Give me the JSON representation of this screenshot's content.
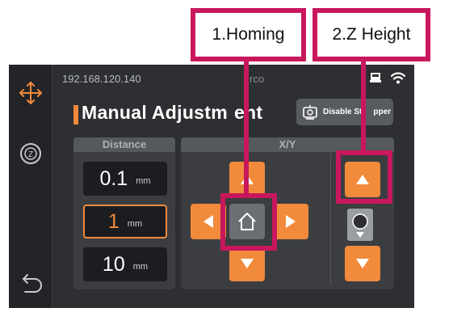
{
  "callouts": {
    "homing": "1.Homing",
    "z_height": "2.Z Height"
  },
  "status_bar": {
    "ip": "192.168.120.140",
    "brand_partial": "rco"
  },
  "page": {
    "title_part1": "Manual Adjustm",
    "title_part2": "ent",
    "disable_stepper_part1": "Disable St",
    "disable_stepper_part2": "pper"
  },
  "distance": {
    "header": "Distance",
    "options": [
      {
        "value": "0.1",
        "unit": "mm",
        "selected": false
      },
      {
        "value": "1",
        "unit": "mm",
        "selected": true
      },
      {
        "value": "10",
        "unit": "mm",
        "selected": false
      }
    ]
  },
  "xy": {
    "header": "X/Y"
  },
  "icons": {
    "sidebar": [
      "move-icon",
      "z-offset-icon",
      "back-icon"
    ],
    "status": [
      "printer-icon",
      "wifi-icon"
    ]
  },
  "colors": {
    "accent": "#f28a3b",
    "highlight": "#c8175d",
    "background": "#2d2f32"
  }
}
